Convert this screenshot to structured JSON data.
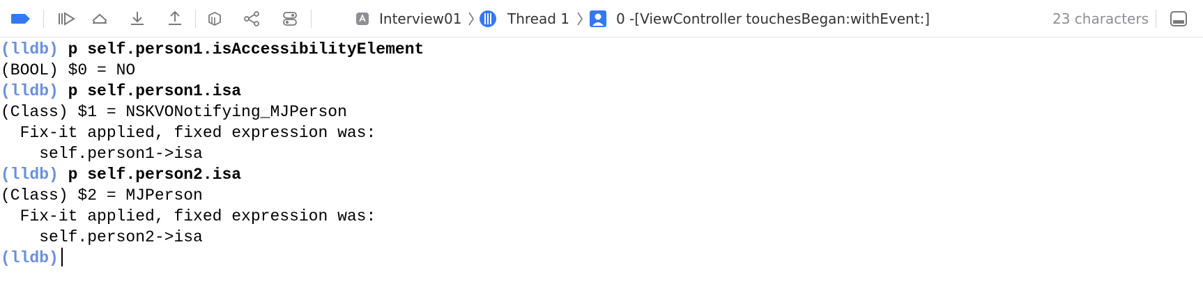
{
  "toolbar": {
    "icons": {
      "breakpoints": "breakpoint-toggle-icon",
      "continue": "continue-execution-icon",
      "step_over": "step-over-icon",
      "step_into": "step-into-icon",
      "step_out": "step-out-icon",
      "debug_view": "view-hierarchy-icon",
      "memory_graph": "memory-graph-icon",
      "environment": "environment-overrides-icon",
      "simulate_location": "location-icon",
      "layout_toggle": "hide-panel-icon"
    },
    "breadcrumbs": {
      "app": "Interview01",
      "thread": "Thread 1",
      "frame": "0 -[ViewController touchesBegan:withEvent:]"
    },
    "char_count": "23 characters",
    "colors": {
      "accent": "#3478f6",
      "prompt": "#6a8fe0",
      "icon": "#7a7a7a"
    }
  },
  "console": {
    "lines": [
      {
        "prompt": "(lldb)",
        "text": " p self.person1.isAccessibilityElement"
      },
      {
        "prompt": "",
        "text": "(BOOL) $0 = NO"
      },
      {
        "prompt": "(lldb)",
        "text": " p self.person1.isa"
      },
      {
        "prompt": "",
        "text": "(Class) $1 = NSKVONotifying_MJPerson"
      },
      {
        "prompt": "",
        "text": "  Fix-it applied, fixed expression was:"
      },
      {
        "prompt": "",
        "text": "    self.person1->isa"
      },
      {
        "prompt": "(lldb)",
        "text": " p self.person2.isa"
      },
      {
        "prompt": "",
        "text": "(Class) $2 = MJPerson"
      },
      {
        "prompt": "",
        "text": "  Fix-it applied, fixed expression was:"
      },
      {
        "prompt": "",
        "text": "    self.person2->isa"
      },
      {
        "prompt": "(lldb)",
        "text": ""
      }
    ]
  }
}
